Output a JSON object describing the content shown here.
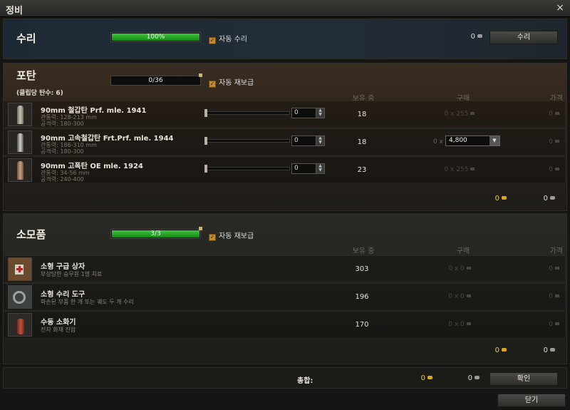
{
  "window": {
    "title": "정비",
    "close_icon": "×"
  },
  "repair": {
    "title": "수리",
    "progress_label": "100%",
    "progress": 1.0,
    "auto_label": "자동 수리",
    "credits": "0",
    "button": "수리"
  },
  "ammo": {
    "title": "포탄",
    "subtitle": "(클립당 탄수: 6)",
    "progress_label": "0/36",
    "progress": 0.0,
    "auto_label": "자동 재보급",
    "headers": {
      "owned": "보유 중",
      "buy": "구매",
      "price": "가격"
    },
    "items": [
      {
        "name": "90mm 철갑탄 Prf. mle. 1941",
        "pen": "관통력: 128-213 mm",
        "dmg": "공격력: 180-300",
        "qty": "0",
        "owned": "18",
        "buy": "0 x 255",
        "price": "0"
      },
      {
        "name": "90mm 고속철갑탄 Frt.Prf. mle. 1944",
        "pen": "관통력: 186-310 mm",
        "dmg": "공격력: 180-300",
        "qty": "0",
        "owned": "18",
        "buy_prefix": "0 x",
        "buy_select": "4,800",
        "price": "0"
      },
      {
        "name": "90mm 고폭탄 OE mle. 1924",
        "pen": "관통력: 34-56 mm",
        "dmg": "공격력: 240-400",
        "qty": "0",
        "owned": "23",
        "buy": "0 x 255",
        "price": "0"
      }
    ],
    "total_gold": "0",
    "total_credits": "0"
  },
  "consumables": {
    "title": "소모품",
    "progress_label": "3/3",
    "progress": 1.0,
    "auto_label": "자동 재보급",
    "headers": {
      "owned": "보유 중",
      "buy": "구매",
      "price": "가격"
    },
    "items": [
      {
        "name": "소형 구급 상자",
        "desc": "부상당한 승무원 1명 치료",
        "owned": "303",
        "buy": "0 x 0",
        "price": "0"
      },
      {
        "name": "소형 수리 도구",
        "desc": "파손된 부품 한 개 또는 궤도 두 개 수리",
        "owned": "196",
        "buy": "0 x 0",
        "price": "0"
      },
      {
        "name": "수동 소화기",
        "desc": "전차 화재 진압",
        "owned": "170",
        "buy": "0 x 0",
        "price": "0"
      }
    ],
    "total_gold": "0",
    "total_credits": "0"
  },
  "footer": {
    "total_label": "총합:",
    "gold": "0",
    "credits": "0",
    "confirm": "확인",
    "close": "닫기"
  }
}
